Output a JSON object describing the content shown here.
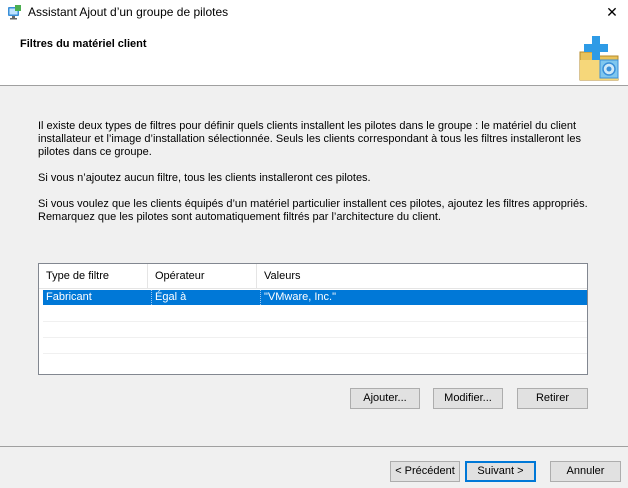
{
  "window": {
    "title": "Assistant Ajout d’un groupe de pilotes",
    "close_glyph": "✕"
  },
  "header": {
    "title": "Filtres du matériel client",
    "icon": "folder-plus-gear-icon"
  },
  "content": {
    "paragraph1": "Il existe deux types de filtres pour définir quels clients installent les pilotes dans le groupe : le matériel du client installateur et l’image d’installation sélectionnée. Seuls les clients correspondant à tous les filtres installeront les pilotes dans ce groupe.",
    "paragraph2": "Si vous n’ajoutez aucun filtre, tous les clients installeront ces pilotes.",
    "paragraph3": "Si vous voulez que les clients équipés d’un matériel particulier installent ces pilotes, ajoutez les filtres appropriés. Remarquez que les pilotes sont automatiquement filtrés par l’architecture du client."
  },
  "filters_table": {
    "columns": [
      "Type de filtre",
      "Opérateur",
      "Valeurs"
    ],
    "rows": [
      [
        "Fabricant",
        "Égal à",
        "\"VMware, Inc.\""
      ]
    ]
  },
  "filter_buttons": {
    "add": "Ajouter...",
    "modify": "Modifier...",
    "remove": "Retirer"
  },
  "nav_buttons": {
    "back": "< Précédent",
    "next": "Suivant >",
    "cancel": "Annuler"
  },
  "colors": {
    "selection": "#0078d7",
    "dialog_bg": "#f0f0f0"
  }
}
